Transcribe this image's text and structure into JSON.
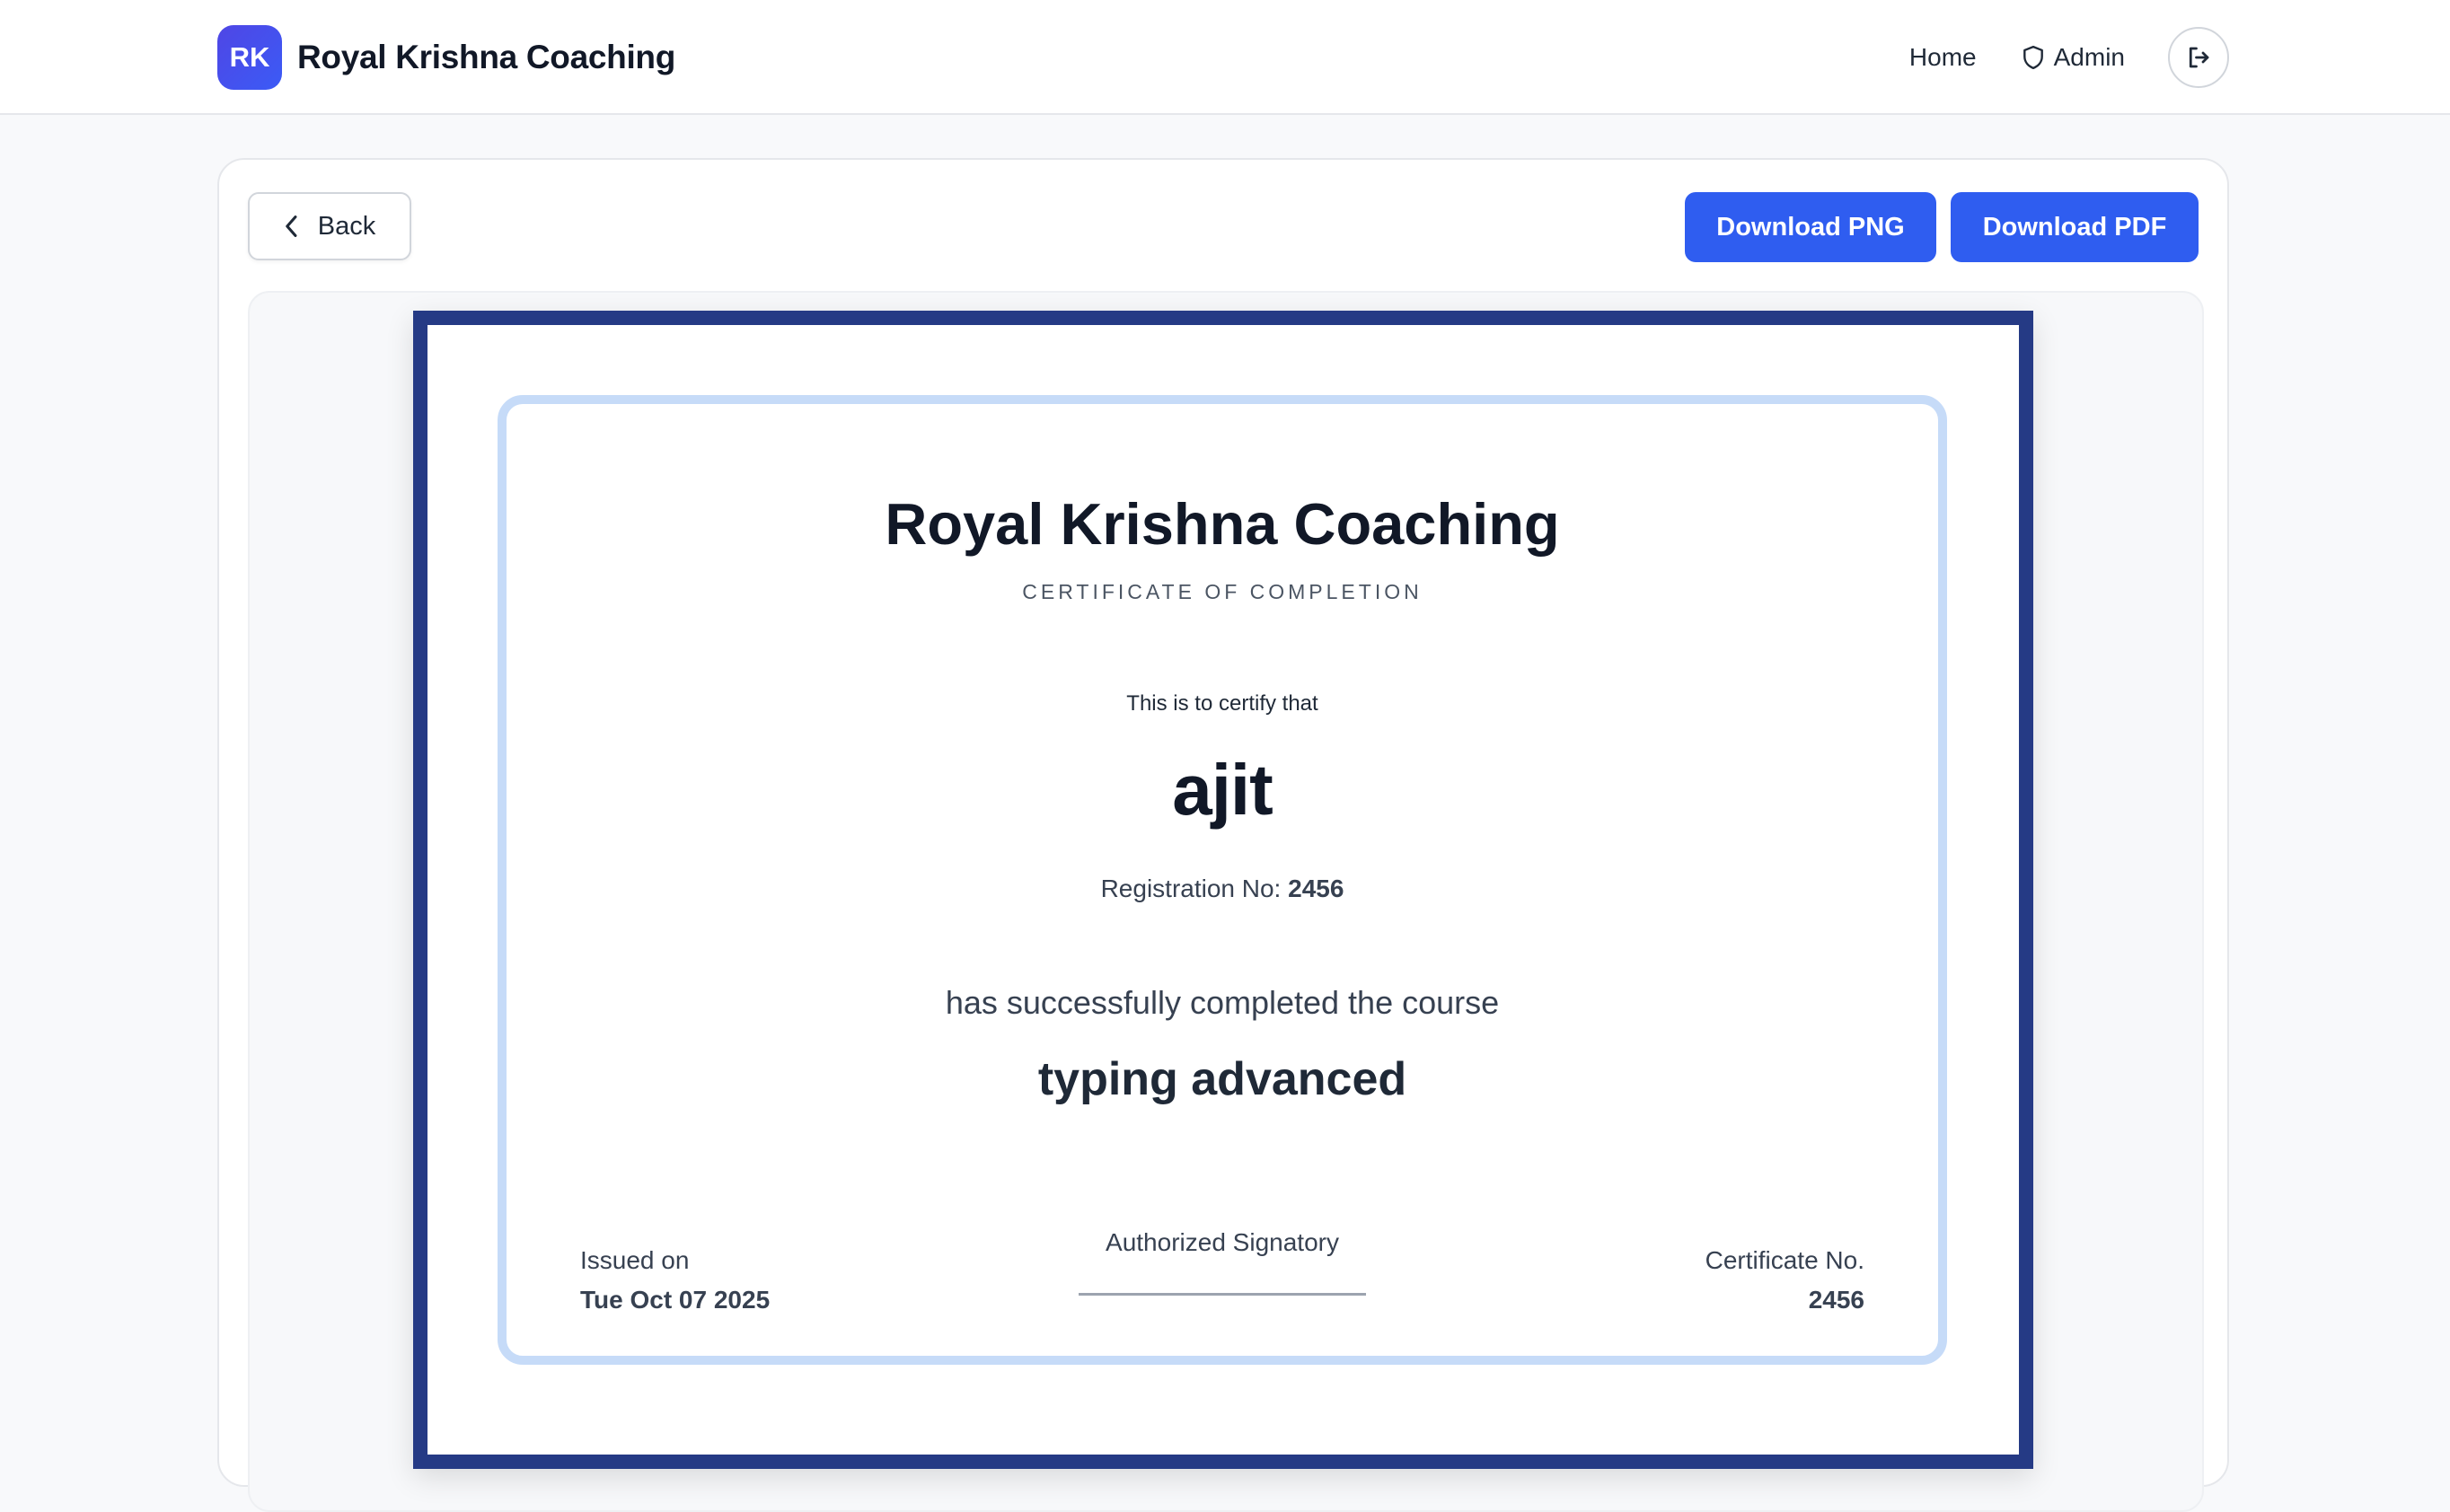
{
  "brand": {
    "badge": "RK",
    "name": "Royal Krishna Coaching"
  },
  "nav": {
    "home": "Home",
    "admin": "Admin",
    "logout_icon": "logout-icon",
    "admin_icon": "shield-icon"
  },
  "toolbar": {
    "back": "Back",
    "download_png": "Download PNG",
    "download_pdf": "Download PDF"
  },
  "certificate": {
    "organization": "Royal Krishna Coaching",
    "type": "CERTIFICATE OF COMPLETION",
    "intro": "This is to certify that",
    "student_name": "ajit",
    "registration_label": "Registration No:",
    "registration_no": "2456",
    "completed_text": "has successfully completed the course",
    "course": "typing advanced",
    "issued_label": "Issued on",
    "issued_date": "Tue Oct 07 2025",
    "signatory": "Authorized Signatory",
    "certificate_no_label": "Certificate No.",
    "certificate_no": "2456"
  },
  "colors": {
    "brand_accent": "#4f46e5",
    "button_primary": "#2f5df0",
    "certificate_border": "#253a85",
    "certificate_inner_border": "#c6dbf8"
  }
}
